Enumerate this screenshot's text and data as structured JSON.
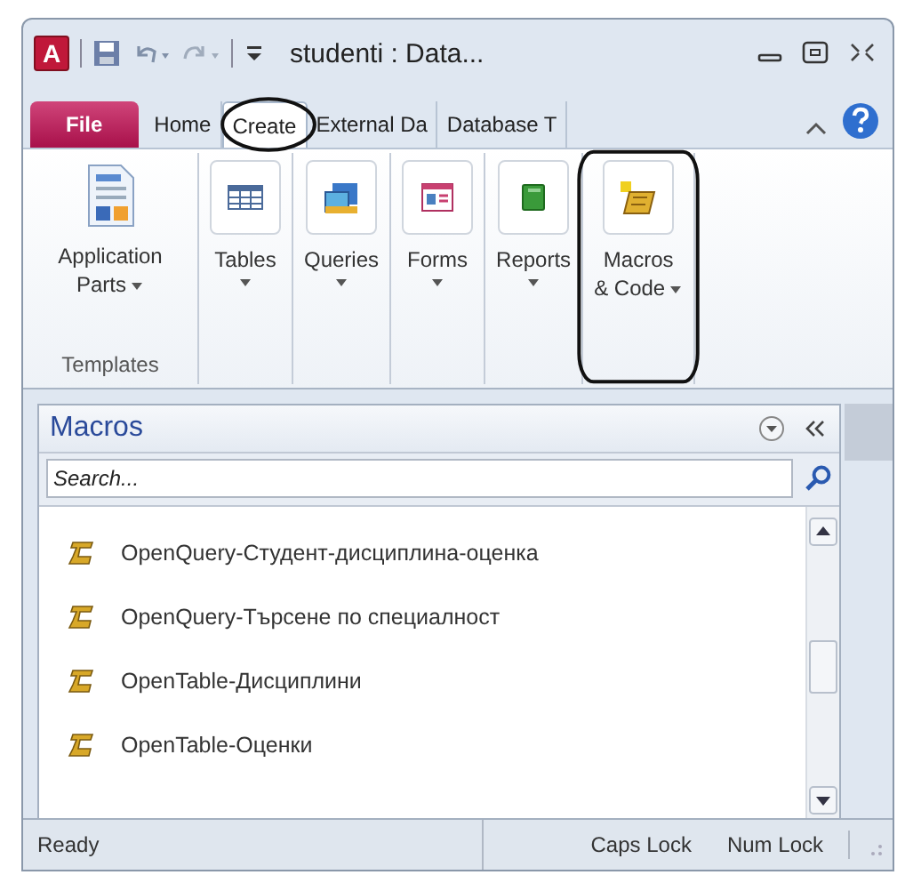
{
  "window": {
    "app_icon": "A",
    "title": "studenti : Data..."
  },
  "tabs": [
    {
      "label": "File",
      "kind": "file",
      "selected": false,
      "circled": false
    },
    {
      "label": "Home",
      "kind": "tab",
      "selected": false,
      "circled": false
    },
    {
      "label": "Create",
      "kind": "tab",
      "selected": true,
      "circled": true
    },
    {
      "label": "External Da",
      "kind": "tab",
      "selected": false,
      "circled": false
    },
    {
      "label": "Database T",
      "kind": "tab",
      "selected": false,
      "circled": false
    }
  ],
  "ribbon": {
    "group_label": "Templates",
    "buttons": [
      {
        "lines": [
          "Application",
          "Parts"
        ],
        "kind": "plain",
        "circled": false
      },
      {
        "lines": [
          "Tables"
        ],
        "kind": "boxed",
        "circled": false
      },
      {
        "lines": [
          "Queries"
        ],
        "kind": "boxed",
        "circled": false
      },
      {
        "lines": [
          "Forms"
        ],
        "kind": "boxed",
        "circled": false
      },
      {
        "lines": [
          "Reports"
        ],
        "kind": "boxed",
        "circled": false
      },
      {
        "lines": [
          "Macros",
          "& Code"
        ],
        "kind": "boxed",
        "circled": true
      }
    ]
  },
  "nav_pane": {
    "title": "Macros",
    "search": {
      "placeholder": "Search..."
    },
    "items": [
      {
        "label": "OpenQuery-Студент-дисциплина-оценка"
      },
      {
        "label": "OpenQuery-Търсене по специалност"
      },
      {
        "label": "OpenTable-Дисциплини"
      },
      {
        "label": "OpenTable-Оценки"
      }
    ]
  },
  "status_bar": {
    "left": "Ready",
    "indicators": [
      "Caps Lock",
      "Num Lock"
    ]
  }
}
